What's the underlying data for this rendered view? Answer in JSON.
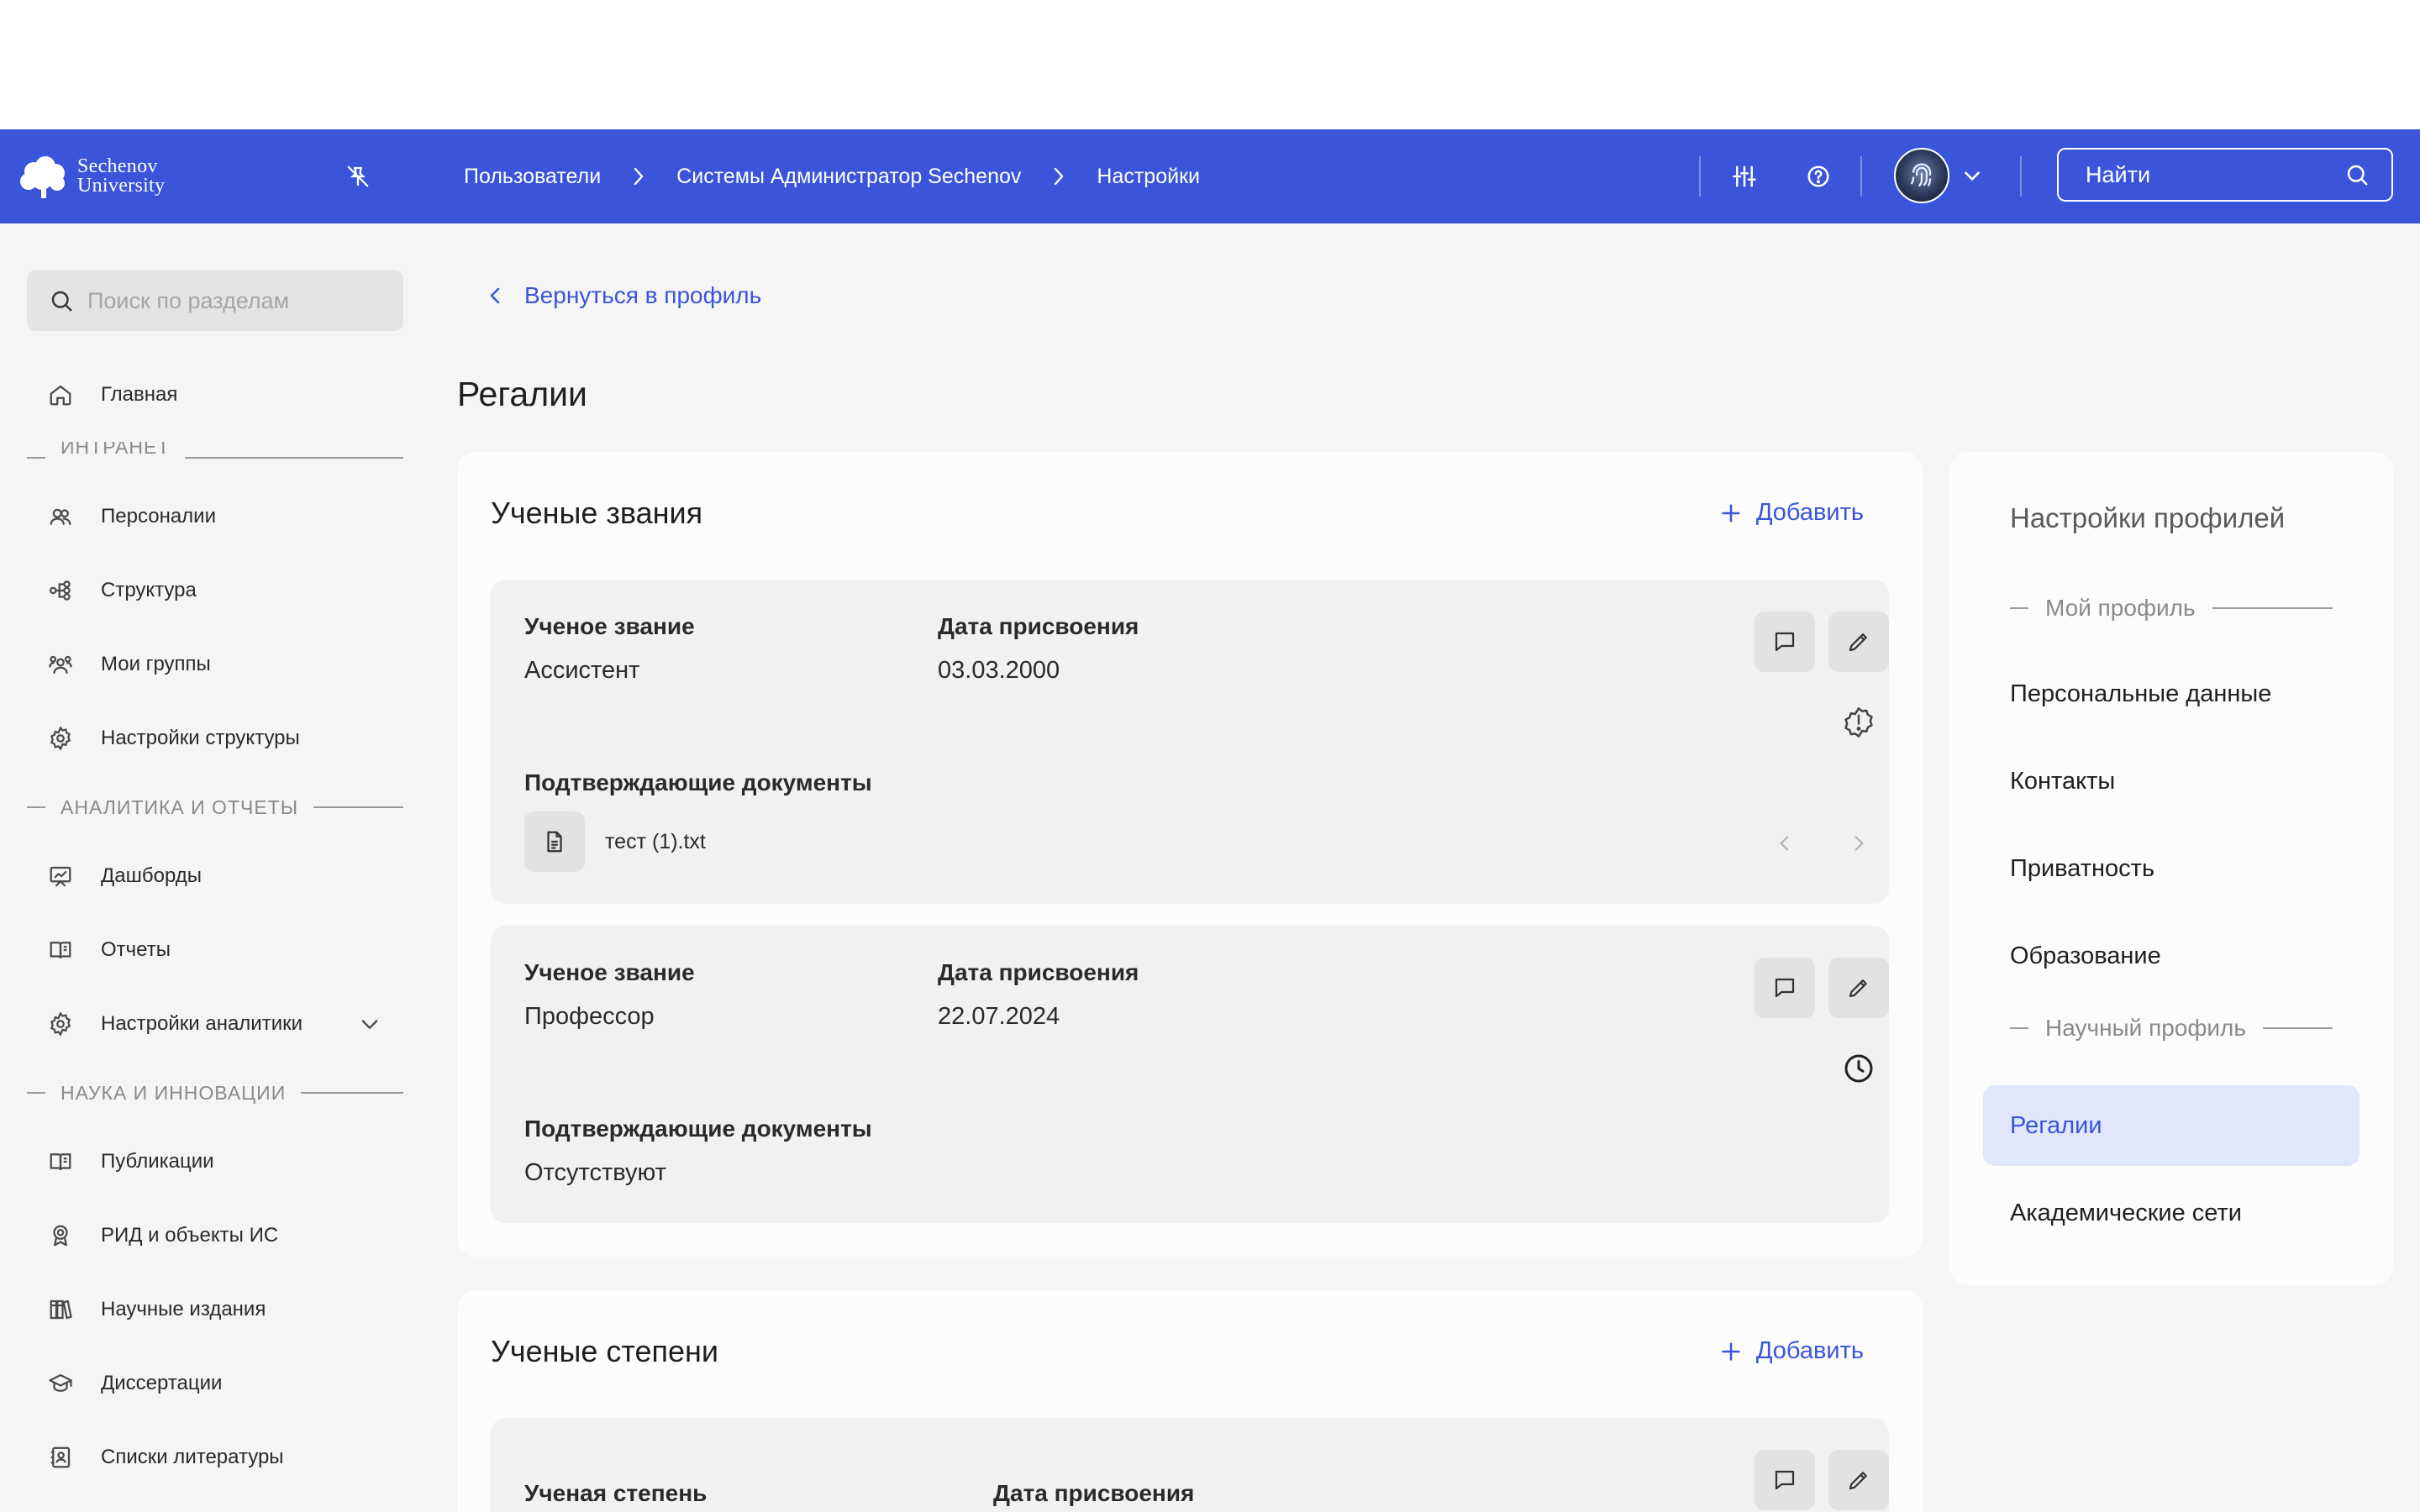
{
  "header": {
    "logo_top": "Sechenov",
    "logo_bottom": "University",
    "breadcrumb": [
      "Пользователи",
      "Системы Администратор Sechenov",
      "Настройки"
    ],
    "search_placeholder": "Найти",
    "accent_color": "#3a55d9"
  },
  "sidebar": {
    "search_placeholder": "Поиск по разделам",
    "home": "Главная",
    "sections": [
      {
        "title": "ИНТРАНЕТ",
        "items": [
          "Персоналии",
          "Структура",
          "Мои группы",
          "Настройки структуры"
        ]
      },
      {
        "title": "АНАЛИТИКА И ОТЧЕТЫ",
        "items": [
          "Дашборды",
          "Отчеты",
          "Настройки аналитики"
        ]
      },
      {
        "title": "НАУКА И ИННОВАЦИИ",
        "items": [
          "Публикации",
          "РИД и объекты ИС",
          "Научные издания",
          "Диссертации",
          "Списки литературы"
        ]
      }
    ]
  },
  "main": {
    "back_link": "Вернуться в профиль",
    "page_title": "Регалии",
    "titles_card": {
      "title": "Ученые звания",
      "add_label": "Добавить",
      "entries": [
        {
          "field1_label": "Ученое звание",
          "field1_value": "Ассистент",
          "field2_label": "Дата присвоения",
          "field2_value": "03.03.2000",
          "docs_label": "Подтверждающие документы",
          "doc_file": "тест (1).txt",
          "status_icon": "alert-badge-icon"
        },
        {
          "field1_label": "Ученое звание",
          "field1_value": "Профессор",
          "field2_label": "Дата присвоения",
          "field2_value": "22.07.2024",
          "docs_label": "Подтверждающие документы",
          "docs_value": "Отсутствуют",
          "status_icon": "clock-icon"
        }
      ]
    },
    "degrees_card": {
      "title": "Ученые степени",
      "add_label": "Добавить",
      "entries": [
        {
          "field1_label": "Ученая степень",
          "field2_label": "Дата присвоения"
        }
      ]
    }
  },
  "right_panel": {
    "title": "Настройки профилей",
    "section1": "Мой профиль",
    "items1": [
      "Персональные данные",
      "Контакты",
      "Приватность",
      "Образование"
    ],
    "section2": "Научный профиль",
    "items2": [
      "Регалии",
      "Академические сети"
    ],
    "active_item": "Регалии"
  }
}
